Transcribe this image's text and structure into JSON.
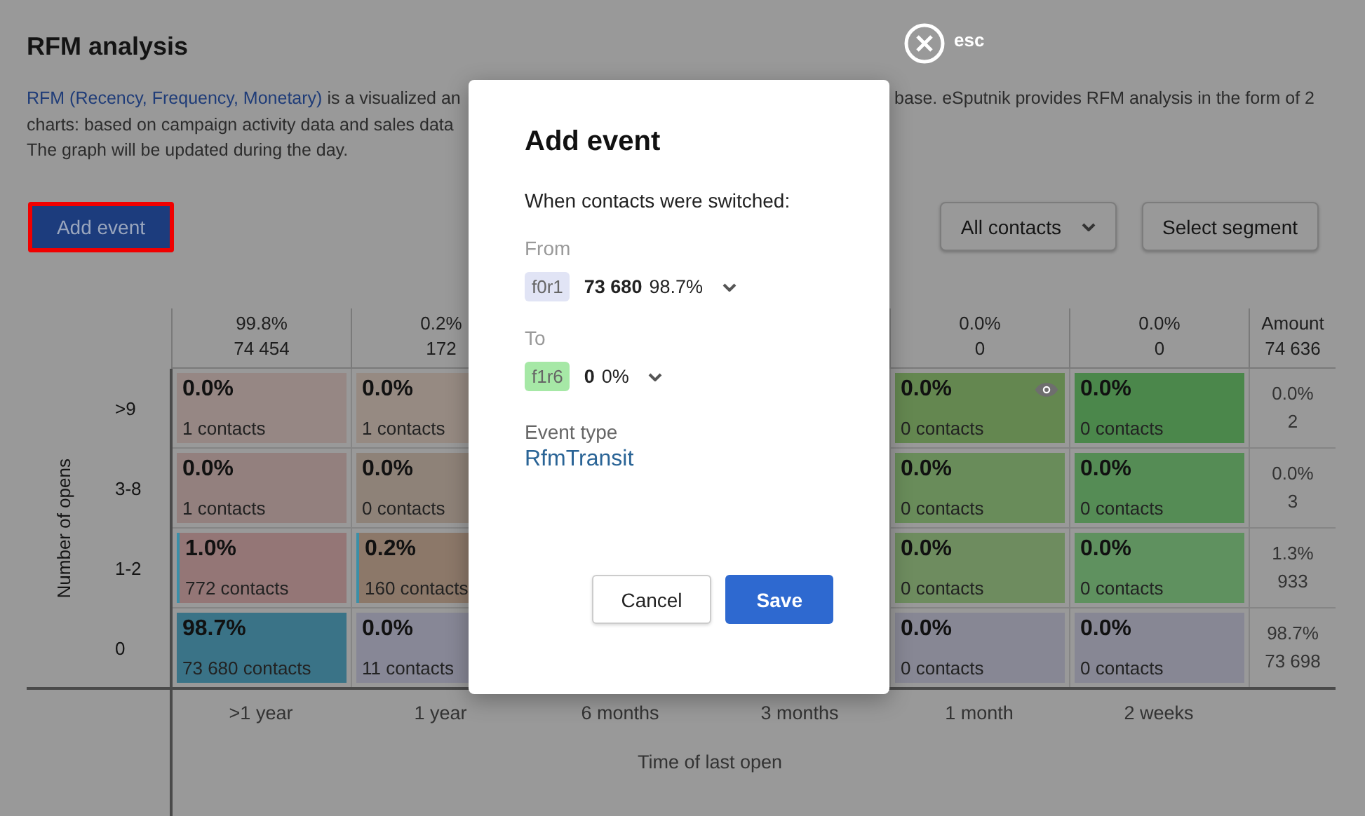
{
  "page": {
    "title": "RFM analysis",
    "description": {
      "link": "RFM (Recency, Frequency, Monetary)",
      "text_1": " is a visualized an",
      "text_2": "base. eSputnik provides RFM analysis in the form of 2",
      "line_2": "charts: based on campaign activity data and sales data",
      "line_3": "The graph will be updated during the day."
    },
    "add_button": {
      "label": "Add event",
      "highlighted": true
    },
    "filter": {
      "label": "All contacts"
    },
    "segment_button": {
      "label": "Select segment"
    }
  },
  "matrix": {
    "y_axis": "Number of opens",
    "x_axis": "Time of last open",
    "total_label": "Amount",
    "total_count": "74 636",
    "column_totals": [
      {
        "pct": "99.8%",
        "count": "74 454"
      },
      {
        "pct": "0.2%",
        "count": "172"
      },
      {
        "pct": "0.0%",
        "count": "0"
      },
      {
        "pct": "0.0%",
        "count": "0"
      }
    ],
    "rows": [
      {
        "label": ">9",
        "total_pct": "0.0%",
        "total_count": "2",
        "cells": [
          {
            "pct": "0.0%",
            "contacts": "1 contacts",
            "color": "#968784",
            "outlined": false,
            "hovered": false
          },
          {
            "pct": "0.0%",
            "contacts": "1 contacts",
            "color": "#968a82",
            "outlined": false
          },
          {
            "pct": "0.0%",
            "contacts": "0 contacts",
            "color": "#648750",
            "outlined": false,
            "hovered": true
          },
          {
            "pct": "0.0%",
            "contacts": "0 contacts",
            "color": "#4b874b",
            "outlined": false,
            "hovered": false
          }
        ]
      },
      {
        "label": "3-8",
        "total_pct": "0.0%",
        "total_count": "3",
        "cells": [
          {
            "pct": "0.0%",
            "contacts": "1 contacts",
            "color": "#93807e",
            "outlined": false,
            "hovered": false
          },
          {
            "pct": "0.0%",
            "contacts": "0 contacts",
            "color": "#8e8278",
            "outlined": false
          },
          {
            "pct": "0.0%",
            "contacts": "0 contacts",
            "color": "#698c5a",
            "outlined": false,
            "hovered": false
          },
          {
            "pct": "0.0%",
            "contacts": "0 contacts",
            "color": "#558c55",
            "outlined": false,
            "hovered": false
          }
        ]
      },
      {
        "label": "1-2",
        "total_pct": "1.3%",
        "total_count": "933",
        "cells": [
          {
            "pct": "1.0%",
            "contacts": "772 contacts",
            "color": "#947676",
            "outlined": true,
            "hovered": false
          },
          {
            "pct": "0.2%",
            "contacts": "160 contacts",
            "color": "#8c7869",
            "outlined": true
          },
          {
            "pct": "0.0%",
            "contacts": "0 contacts",
            "color": "#6e8c5f",
            "outlined": false,
            "hovered": false
          },
          {
            "pct": "0.0%",
            "contacts": "0 contacts",
            "color": "#5f915f",
            "outlined": false,
            "hovered": false
          }
        ]
      },
      {
        "label": "0",
        "total_pct": "98.7%",
        "total_count": "73 698",
        "cells": [
          {
            "pct": "98.7%",
            "contacts": "73 680 contacts",
            "color": "#3a7387",
            "outlined": false,
            "hovered": false
          },
          {
            "pct": "0.0%",
            "contacts": "11 contacts",
            "color": "#878796",
            "outlined": false
          },
          {
            "pct": "0.0%",
            "contacts": "0 contacts",
            "color": "#878794",
            "outlined": false,
            "hovered": false
          },
          {
            "pct": "0.0%",
            "contacts": "0 contacts",
            "color": "#878794",
            "outlined": false,
            "hovered": false
          }
        ]
      }
    ],
    "x_labels": [
      ">1 year",
      "1 year",
      "6 months",
      "3 months",
      "1 month",
      "2 weeks"
    ]
  },
  "close": {
    "label": "esc"
  },
  "dialog": {
    "title": "Add event",
    "prompt": "When contacts were switched:",
    "transitions": [
      {
        "label": "From",
        "tag": "f0r1",
        "color": "#e1e4f5",
        "count": "73 680",
        "pct": "98.7%"
      },
      {
        "label": "To",
        "tag": "f1r6",
        "color": "#a6e8a6",
        "count": "0",
        "pct": "0%"
      }
    ],
    "event_type": {
      "label": "Event type",
      "value": "RfmTransit"
    },
    "buttons": [
      {
        "label": "Cancel",
        "kind": "secondary"
      },
      {
        "label": "Save",
        "kind": "primary"
      }
    ]
  }
}
